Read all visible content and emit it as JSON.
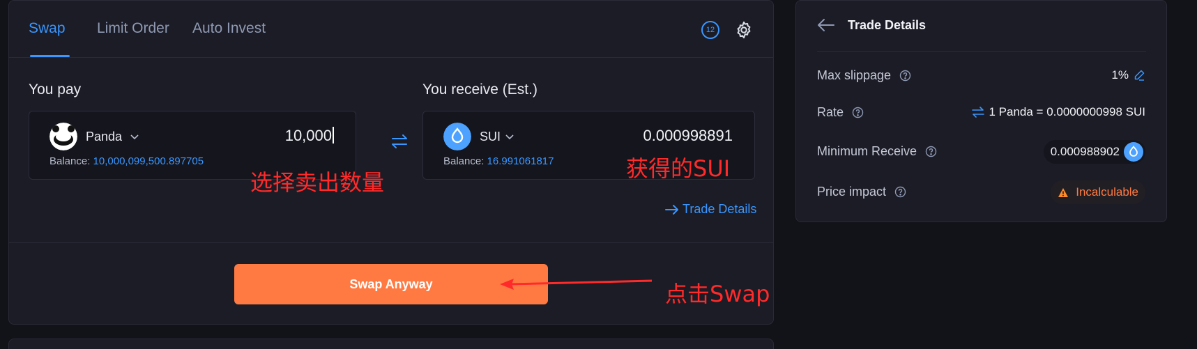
{
  "tabs": {
    "swap": "Swap",
    "limit_order": "Limit Order",
    "auto_invest": "Auto Invest"
  },
  "timer_value": "12",
  "pay": {
    "label": "You pay",
    "token": "Panda",
    "amount": "10,000",
    "balance_label": "Balance:",
    "balance_value": "10,000,099,500.897705"
  },
  "receive": {
    "label": "You receive (Est.)",
    "token": "SUI",
    "amount": "0.000998891",
    "balance_label": "Balance:",
    "balance_value": "16.991061817"
  },
  "trade_details_link": "Trade Details",
  "swap_button": "Swap Anyway",
  "annotations": {
    "pay_note": "选择卖出数量",
    "receive_note": "获得的SUI",
    "button_note": "点击Swap"
  },
  "details": {
    "title": "Trade Details",
    "max_slippage_label": "Max slippage",
    "max_slippage_value": "1%",
    "rate_label": "Rate",
    "rate_value": "1 Panda = 0.0000000998 SUI",
    "min_receive_label": "Minimum Receive",
    "min_receive_value": "0.000988902",
    "price_impact_label": "Price impact",
    "price_impact_value": "Incalculable"
  },
  "colors": {
    "accent_blue": "#3a97ff",
    "swap_button": "#ff7a42",
    "annotation_red": "#ff2a2a",
    "warning_orange": "#ff7a42"
  },
  "icons": [
    "timer-icon",
    "gear-icon",
    "panda-token-icon",
    "sui-token-icon",
    "chevron-down-icon",
    "swap-arrows-icon",
    "arrow-right-icon",
    "back-arrow-icon",
    "question-icon",
    "edit-icon",
    "warning-icon"
  ]
}
